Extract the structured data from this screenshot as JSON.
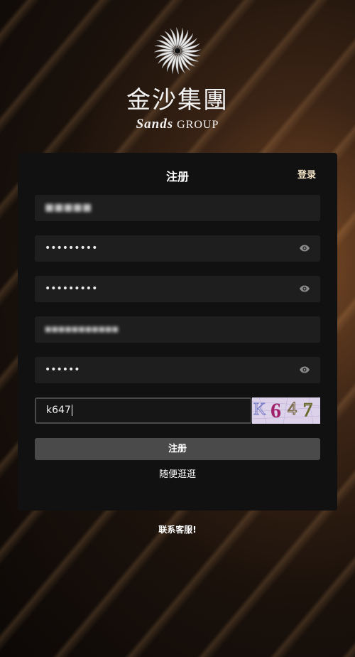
{
  "brand": {
    "name_cn": "金沙集團",
    "name_en_script": "Sands",
    "name_en_rest": "GROUP"
  },
  "form": {
    "title": "注册",
    "login_link": "登录",
    "fields": [
      {
        "type": "text",
        "value": "■■■■■"
      },
      {
        "type": "password",
        "value": "•••••••••"
      },
      {
        "type": "password",
        "value": "•••••••••"
      },
      {
        "type": "text",
        "value": "■■■■■■■■■■■"
      },
      {
        "type": "password",
        "value": "••••••"
      }
    ],
    "captcha": {
      "input_value": "k647",
      "image_text": "K647"
    },
    "submit_label": "注册",
    "browse_link": "随便逛逛"
  },
  "footer": {
    "contact": "联系客服!"
  }
}
